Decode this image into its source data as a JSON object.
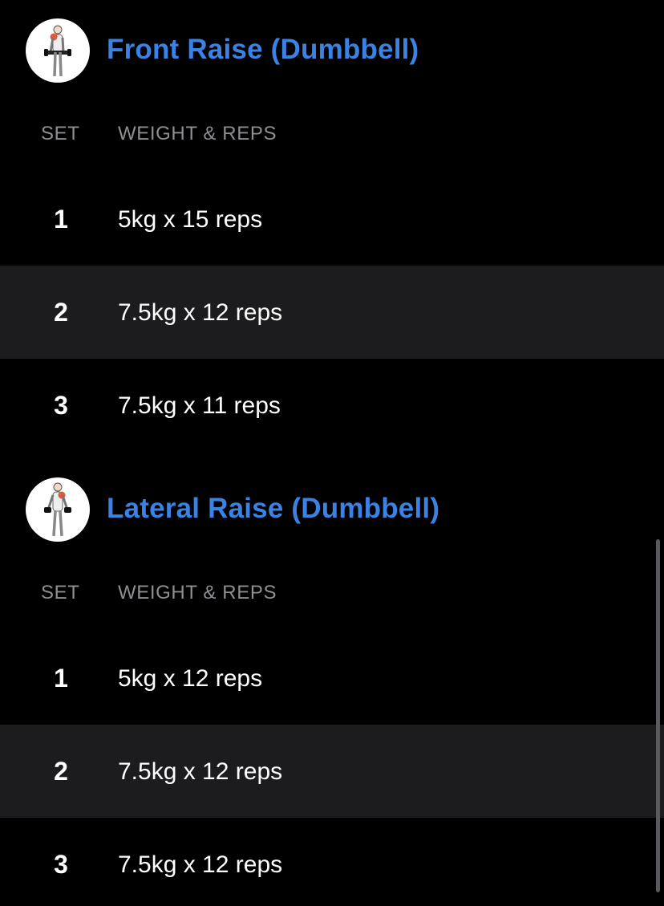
{
  "columns": {
    "set_label": "SET",
    "weight_reps_label": "WEIGHT & REPS"
  },
  "colors": {
    "background": "#000000",
    "shaded_row": "#1c1c1e",
    "title_blue": "#3a82e4",
    "header_gray": "#8e8e93",
    "muscle_highlight": "#e05a3c"
  },
  "exercises": [
    {
      "title": "Front Raise (Dumbbell)",
      "icon": "front-raise-figure-icon",
      "sets": [
        {
          "number": "1",
          "value": "5kg x 15 reps"
        },
        {
          "number": "2",
          "value": "7.5kg x 12 reps"
        },
        {
          "number": "3",
          "value": "7.5kg x 11 reps"
        }
      ]
    },
    {
      "title": "Lateral Raise (Dumbbell)",
      "icon": "lateral-raise-figure-icon",
      "sets": [
        {
          "number": "1",
          "value": "5kg x 12 reps"
        },
        {
          "number": "2",
          "value": "7.5kg x 12 reps"
        },
        {
          "number": "3",
          "value": "7.5kg x 12 reps"
        }
      ]
    }
  ]
}
